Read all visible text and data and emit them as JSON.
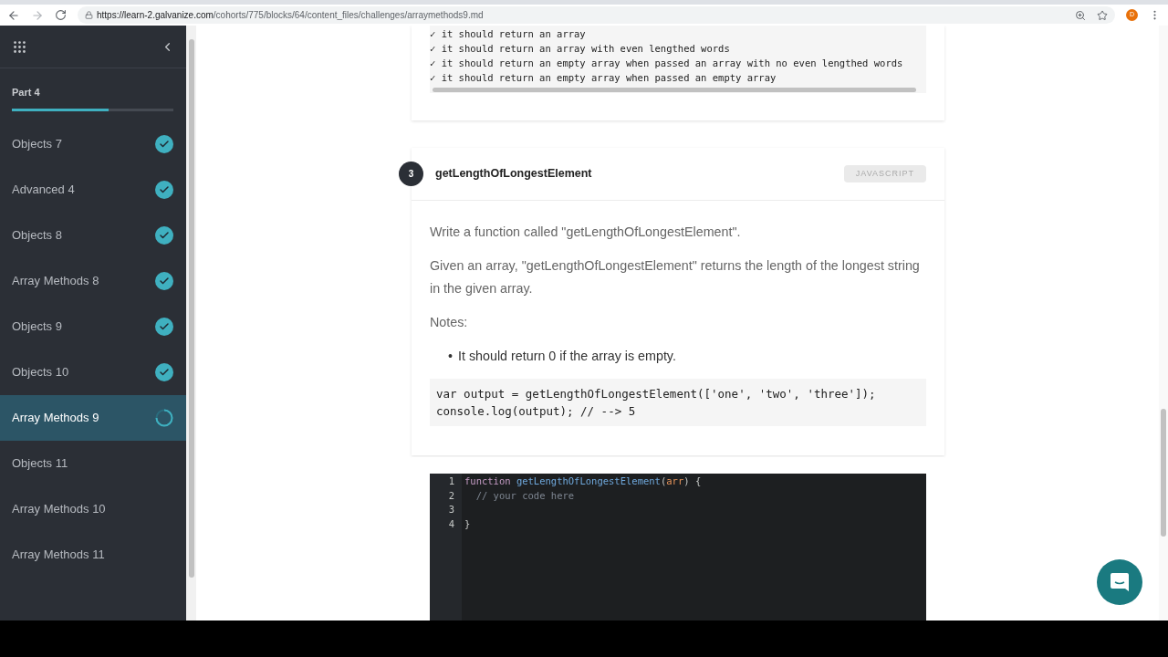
{
  "browser": {
    "url_host": "https://learn-2.galvanize.com",
    "url_path": "/cohorts/775/blocks/64/content_files/challenges/arraymethods9.md",
    "profile": "D"
  },
  "sidebar": {
    "section": "Part 4",
    "level": 0.6,
    "items": [
      {
        "label": "Objects 7",
        "kind": "done",
        "selected": false
      },
      {
        "label": "Advanced 4",
        "kind": "done",
        "selected": false
      },
      {
        "label": "Objects 8",
        "kind": "done",
        "selected": false
      },
      {
        "label": "Array Methods 8",
        "kind": "done",
        "selected": false
      },
      {
        "label": "Objects 9",
        "kind": "done",
        "selected": false
      },
      {
        "label": "Objects 10",
        "kind": "done",
        "selected": false
      },
      {
        "label": "Array Methods 9",
        "kind": "pending",
        "selected": true
      },
      {
        "label": "Objects 11",
        "kind": "plain",
        "selected": false
      },
      {
        "label": "Array Methods 10",
        "kind": "plain",
        "selected": false
      },
      {
        "label": "Array Methods 11",
        "kind": "plain",
        "selected": false
      }
    ]
  },
  "test_output": [
    "✓ it should return an array",
    "✓ it should return an array with even lengthed words",
    "✓ it should return an empty array when passed an array with no even lengthed words",
    "✓ it should return an empty array when passed an empty array"
  ],
  "challenge": {
    "number": "3",
    "title": "getLengthOfLongestElement",
    "language": "JAVASCRIPT",
    "paragraphs": [
      "Write a function called \"getLengthOfLongestElement\".",
      "Given an array, \"getLengthOfLongestElement\" returns the length of the longest string in the given array.",
      "Notes:"
    ],
    "bullets": [
      {
        "marker": "•",
        "text": "It should return 0 if the array is empty."
      }
    ],
    "example": [
      "var output = getLengthOfLongestElement(['one', 'two', 'three']);",
      "console.log(output); // --> 5"
    ]
  },
  "editor": {
    "lines": [
      {
        "number": "1",
        "tokens": [
          {
            "kind": "keyword",
            "text": "function "
          },
          {
            "kind": "name",
            "text": "getLengthOfLongestElement"
          },
          {
            "kind": "plain",
            "text": "("
          },
          {
            "kind": "param",
            "text": "arr"
          },
          {
            "kind": "plain",
            "text": ") {"
          }
        ]
      },
      {
        "number": "2",
        "tokens": [
          {
            "kind": "comment",
            "text": "  // your code here"
          }
        ]
      },
      {
        "number": "3"
      },
      {
        "number": "4",
        "tokens": [
          {
            "kind": "plain",
            "text": "}"
          }
        ]
      }
    ]
  }
}
